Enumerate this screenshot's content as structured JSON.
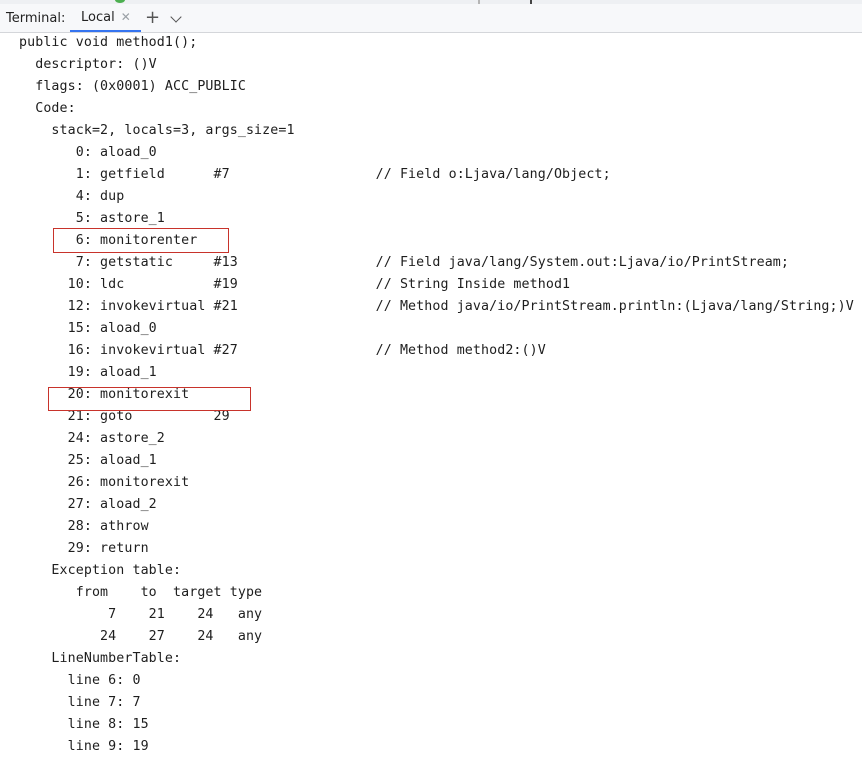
{
  "tool_window": {
    "title": "Terminal:",
    "tabs": [
      {
        "label": "Local",
        "close_icon": "close-icon"
      }
    ],
    "add_icon": "plus-icon",
    "menu_icon": "chevron-down-icon"
  },
  "terminal": {
    "lines": [
      "public void method1();",
      "  descriptor: ()V",
      "  flags: (0x0001) ACC_PUBLIC",
      "  Code:",
      "    stack=2, locals=3, args_size=1",
      "       0: aload_0",
      "       1: getfield      #7                  // Field o:Ljava/lang/Object;",
      "       4: dup",
      "       5: astore_1",
      "       6: monitorenter",
      "       7: getstatic     #13                 // Field java/lang/System.out:Ljava/io/PrintStream;",
      "      10: ldc           #19                 // String Inside method1",
      "      12: invokevirtual #21                 // Method java/io/PrintStream.println:(Ljava/lang/String;)V",
      "      15: aload_0",
      "      16: invokevirtual #27                 // Method method2:()V",
      "      19: aload_1",
      "      20: monitorexit",
      "      21: goto          29",
      "      24: astore_2",
      "      25: aload_1",
      "      26: monitorexit",
      "      27: aload_2",
      "      28: athrow",
      "      29: return",
      "    Exception table:",
      "       from    to  target type",
      "           7    21    24   any",
      "          24    27    24   any",
      "    LineNumberTable:",
      "      line 6: 0",
      "      line 7: 7",
      "      line 8: 15",
      "      line 9: 19"
    ]
  },
  "annotations": {
    "highlight_color": "#c8332b",
    "highlighted_instructions": [
      "6: monitorenter",
      "20: monitorexit"
    ]
  },
  "colors": {
    "tab_accent": "#3574f0",
    "text": "#1e1e1e",
    "background": "#ffffff"
  }
}
